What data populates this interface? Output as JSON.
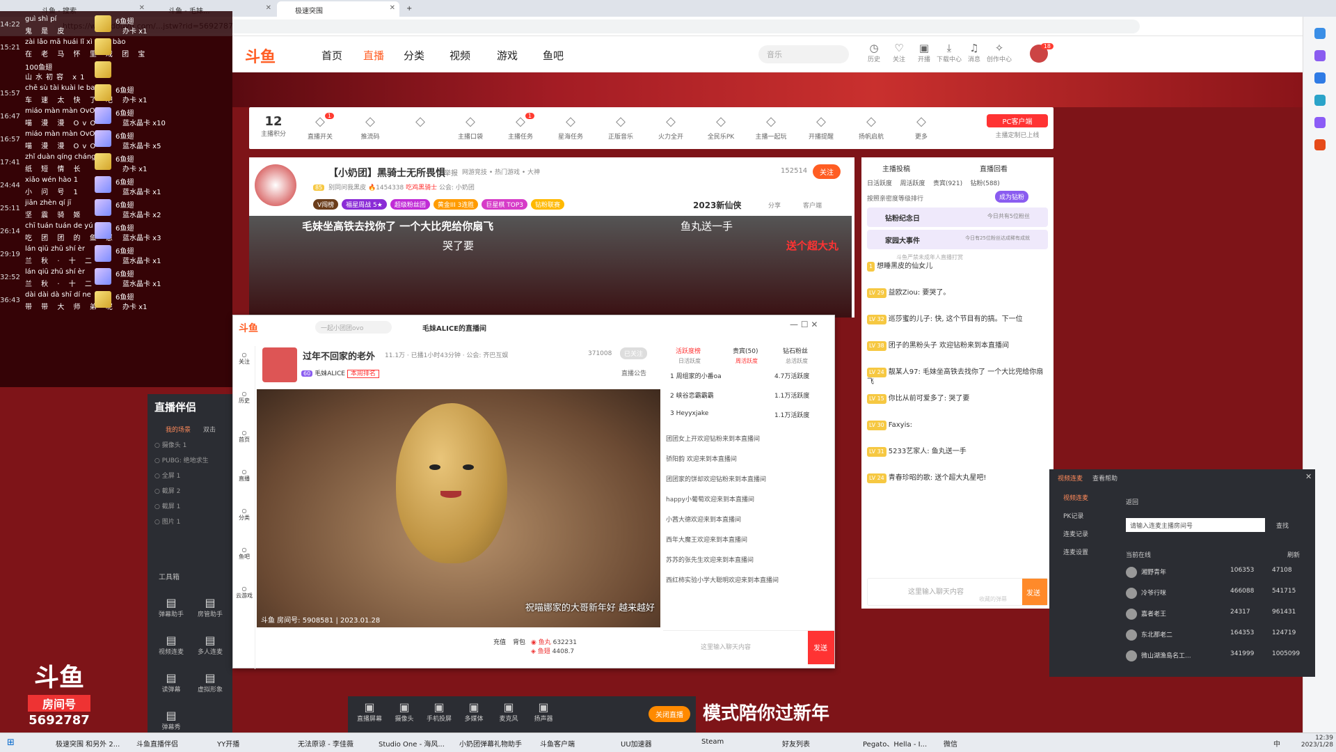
{
  "browser": {
    "tabs": [
      {
        "label": "斗鱼 - 搜索"
      },
      {
        "label": "斗鱼 - 毛妹... "
      },
      {
        "label": "极速突围"
      }
    ],
    "address": "https://www.douyu.com/...jstw?rid=5692787"
  },
  "topnav": {
    "logo": "斗鱼",
    "items": [
      "首页",
      "直播",
      "分类",
      "视频",
      "游戏",
      "鱼吧"
    ],
    "active": "直播",
    "search_placeholder": "音乐",
    "icons": [
      {
        "label": "历史",
        "icon": "clock-icon"
      },
      {
        "label": "关注",
        "icon": "heart-icon"
      },
      {
        "label": "开播",
        "icon": "camera-icon"
      },
      {
        "label": "下载中心",
        "icon": "download-icon"
      },
      {
        "label": "消息",
        "icon": "bell-icon"
      },
      {
        "label": "创作中心",
        "icon": "bulb-icon"
      }
    ],
    "avatar_badge": "18"
  },
  "streamer_bar": {
    "score": "12",
    "score_label": "主播积分",
    "items": [
      {
        "label": "直播开关",
        "badge": "1"
      },
      {
        "label": "推流码",
        "badge": ""
      },
      {
        "label": "",
        "badge": ""
      },
      {
        "label": "主播口袋",
        "badge": ""
      },
      {
        "label": "主播任务",
        "badge": "1"
      },
      {
        "label": "星海任务",
        "badge": ""
      },
      {
        "label": "正版音乐",
        "badge": ""
      },
      {
        "label": "火力全开",
        "badge": ""
      },
      {
        "label": "全民乐PK",
        "badge": ""
      },
      {
        "label": "主播一起玩",
        "badge": ""
      },
      {
        "label": "开播提醒",
        "badge": ""
      },
      {
        "label": "扬帆启航",
        "badge": ""
      },
      {
        "label": "更多",
        "badge": ""
      }
    ],
    "pc_client": "PC客户端",
    "pc_sub": "主播定制已上线"
  },
  "room": {
    "title": "【小奶团】黑骑士无所畏惧",
    "report": "举报",
    "category": "网游竞技 • 热门游戏 • 大神",
    "hot": "152514",
    "follow": "关注",
    "level": "85",
    "tag1": "别同问我黑皮",
    "fans": "1454338",
    "tag2": "吃鸡黑骑士",
    "notice": "公会: 小奶团",
    "pills": [
      "V闯榜",
      "福星周战 5★",
      "超级粉丝团",
      "黄金III 3连胜",
      "巨星棋 TOP3",
      "钻粉联赛"
    ],
    "event": "2023新仙侠",
    "share": "分享",
    "client": "客户端",
    "danmu1": "毛妹坐高铁去找你了 一个大比兜给你扇飞",
    "danmu2": "鱼丸送一手",
    "danmu3": "哭了要",
    "danmu4": "送个超大丸"
  },
  "right_chat": {
    "tabs_top": [
      "主播投稿",
      "直播回看"
    ],
    "tabs": [
      "日活跃度",
      "周活跃度",
      "贵宾(921)",
      "钻粉(588)"
    ],
    "rank_hint": "按照亲密度等级排行",
    "become_fan": "成为钻粉",
    "card1": "钻粉纪念日",
    "card1_sub": "今日共有5位粉丝",
    "card2": "家园大事件",
    "card2_sub": "今日有25位粉丝达成稀有成就",
    "system": "斗鱼严禁未成年人直播打赏",
    "messages": [
      {
        "lv": "1",
        "text": "想睡黑皮的仙女儿"
      },
      {
        "lv": "LV 29",
        "text": "益欧Ziou: 要哭了。"
      },
      {
        "lv": "LV 32",
        "text": "巡莎蜜的儿子: 快, 这个节目有的搞。下一位"
      },
      {
        "lv": "LV 38",
        "text": "团子的黑粉头子 欢迎钻粉来到本直播间"
      },
      {
        "lv": "LV 24",
        "text": "靓某人97: 毛妹坐高铁去找你了 一个大比兜给你扇飞"
      },
      {
        "lv": "LV 15",
        "text": "你比从前可爱多了: 哭了要"
      },
      {
        "lv": "LV 30",
        "text": "Faxyis:"
      },
      {
        "lv": "LV 31",
        "text": "5233艺家人: 鱼丸送一手"
      },
      {
        "lv": "LV 24",
        "text": "青春珍昭的歌: 送个超大丸星吧!"
      }
    ],
    "input_placeholder": "这里输入聊天内容",
    "send": "发送",
    "collect": "收藏的弹幕"
  },
  "overlay_gifts": [
    {
      "time": "14:22",
      "name": "guì shì pí",
      "hanzi": "鬼 是 皮",
      "gift": "6鱼翅",
      "count": "办卡 x1",
      "type": "a"
    },
    {
      "time": "15:21",
      "name": "zài lǎo mā huái lǐ xì tuán bào",
      "hanzi": "在 老 马 怀 里 戏 团 宝",
      "gift": "",
      "count": "",
      "type": "a"
    },
    {
      "time": "",
      "name": "100鱼翅",
      "hanzi": "山水初容 x1",
      "gift": "",
      "count": "",
      "type": "a"
    },
    {
      "time": "15:57",
      "name": "chē sù tài kuài le ba",
      "hanzi": "车 速 太 快 了 吧",
      "gift": "6鱼翅",
      "count": "办卡 x1",
      "type": "a"
    },
    {
      "time": "16:47",
      "name": "miáo màn màn OvO",
      "hanzi": "喵 漫 漫 OvO",
      "gift": "6鱼翅",
      "count": "蓝水晶卡 x10",
      "type": "b"
    },
    {
      "time": "16:57",
      "name": "miáo màn màn OvO",
      "hanzi": "喵 漫 漫 OvO",
      "gift": "6鱼翅",
      "count": "蓝水晶卡 x5",
      "type": "b"
    },
    {
      "time": "17:41",
      "name": "zhǐ duàn qíng cháng",
      "hanzi": "纸 短 情 长",
      "gift": "6鱼翅",
      "count": "办卡 x1",
      "type": "a"
    },
    {
      "time": "24:44",
      "name": "xiǎo wén hào 1",
      "hanzi": "小 问 号 1",
      "gift": "6鱼翅",
      "count": "蓝水晶卡 x1",
      "type": "b"
    },
    {
      "time": "25:11",
      "name": "jiān zhèn qí jī",
      "hanzi": "坚 震 骑 姬",
      "gift": "6鱼翅",
      "count": "蓝水晶卡 x2",
      "type": "b"
    },
    {
      "time": "26:14",
      "name": "chī tuán tuán de yú zài",
      "hanzi": "吃 团 团 的 鱼 崽",
      "gift": "6鱼翅",
      "count": "蓝水晶卡 x3",
      "type": "b"
    },
    {
      "time": "29:19",
      "name": "lán qiū zhū shí èr",
      "hanzi": "兰 秋 · 十 二",
      "gift": "6鱼翅",
      "count": "蓝水晶卡 x1",
      "type": "b"
    },
    {
      "time": "32:52",
      "name": "lán qiū zhū shí èr",
      "hanzi": "兰 秋 · 十 二",
      "gift": "6鱼翅",
      "count": "蓝水晶卡 x1",
      "type": "b"
    },
    {
      "time": "36:43",
      "name": "dài dài dà shī dí ne",
      "hanzi": "带 带 大 师 弟 呢",
      "gift": "6鱼翅",
      "count": "办卡 x1",
      "type": "a"
    }
  ],
  "helper": {
    "title": "直播伴侣",
    "tabs": [
      "我的场景",
      "双击"
    ],
    "sources": [
      "摄像头 1",
      "PUBG: 绝地求生",
      "全屏 1",
      "截屏 2",
      "截屏 1",
      "图片 1"
    ],
    "tools": "工具箱",
    "tool_items": [
      "弹幕助手",
      "房管助手",
      "视频连麦",
      "多人连麦",
      "读弹幕",
      "虚拟形象",
      "弹幕秀"
    ]
  },
  "room_number": {
    "label": "房间号",
    "value": "5692787"
  },
  "float_window": {
    "search_placeholder": "一起小团团ovo",
    "tab_title": "毛妹ALICE的直播间",
    "title": "过年不回家的老外",
    "hot": "11.1万",
    "duration": "已播1小时43分钟",
    "guild": "公会: 齐巴互娱",
    "count": "371008",
    "followed": "已关注",
    "name": "毛妹ALICE",
    "level": "60",
    "rank": "本周排名",
    "notice": "直播公告",
    "video_caption": "斗鱼 房间号: 5908581 | 2023.01.28",
    "video_overlay": "祝喵娜家的大哥新年好 越来越好",
    "left_nav": [
      "关注",
      "历史",
      "首页",
      "直播",
      "分类",
      "鱼吧",
      "云游戏"
    ],
    "rank_tabs": [
      "活跃度榜",
      "贵宾(50)",
      "钻石粉丝"
    ],
    "rank_sub": [
      "日活跃度",
      "周活跃度",
      "总活跃度"
    ],
    "ranks": [
      {
        "n": "1",
        "name": "周组家的小番oa",
        "val": "4.7万活跃度"
      },
      {
        "n": "2",
        "name": "峡谷恋霸霸霸",
        "val": "1.1万活跃度"
      },
      {
        "n": "3",
        "name": "Heyyxjake",
        "val": "1.1万活跃度"
      }
    ],
    "chat": [
      "团团女上开欢迎钻粉来到本直播间",
      "骄阳韵 欢迎来到本直播间",
      "团团家的饼却欢迎钻粉来到本直播间",
      "happy小葡萄欢迎来到本直播间",
      "小茜大德欢迎来到本直播间",
      "西年大魔王欢迎来到本直播间",
      "苏苏的张先生欢迎来到本直播间",
      "西红柿实验小学大聪明欢迎来到本直播间"
    ],
    "chat_input": "这里输入聊天内容",
    "send": "发送",
    "fishball": "632231",
    "fishwing": "4408.7",
    "recharge": "充值",
    "bag": "背包"
  },
  "bottom_controls": {
    "items": [
      "直播屏幕",
      "摄像头",
      "手机投屏",
      "多媒体",
      "麦克风",
      "扬声器"
    ],
    "end": "关闭直播",
    "banner": "模式陪你过新年"
  },
  "pk_panel": {
    "tabs": [
      "视频连麦",
      "查看帮助"
    ],
    "left": [
      "视频连麦",
      "PK记录",
      "连麦记录",
      "连麦设置"
    ],
    "back": "返回",
    "input": "请输入连麦主播房间号",
    "find": "查找",
    "online": "当前在线",
    "refresh": "刷新",
    "list": [
      {
        "name": "湘野青年",
        "a": "106353",
        "b": "47108"
      },
      {
        "name": "冷爷行咪",
        "a": "466088",
        "b": "541715"
      },
      {
        "name": "嘉者老王",
        "a": "24317",
        "b": "961431"
      },
      {
        "name": "东北那老二",
        "a": "164353",
        "b": "124719"
      },
      {
        "name": "微山湖渔島名工...",
        "a": "341999",
        "b": "1005099"
      }
    ]
  },
  "taskbar": {
    "items": [
      "极速突围 和另外 2...",
      "斗鱼直播伴侣",
      "YY开播",
      "无法原谅 - 李佳薇",
      "Studio One - 海风...",
      "小奶团弹幕礼物助手",
      "斗鱼客户端",
      "UU加速器",
      "Steam",
      "好友列表",
      "Pegato、Hella - I...",
      "微信"
    ],
    "time": "12:39",
    "date": "2023/1/28",
    "ime": "中"
  },
  "colors": {
    "brand": "#ff5d23",
    "banner": "#a31c24",
    "dark": "#2b2d33"
  }
}
